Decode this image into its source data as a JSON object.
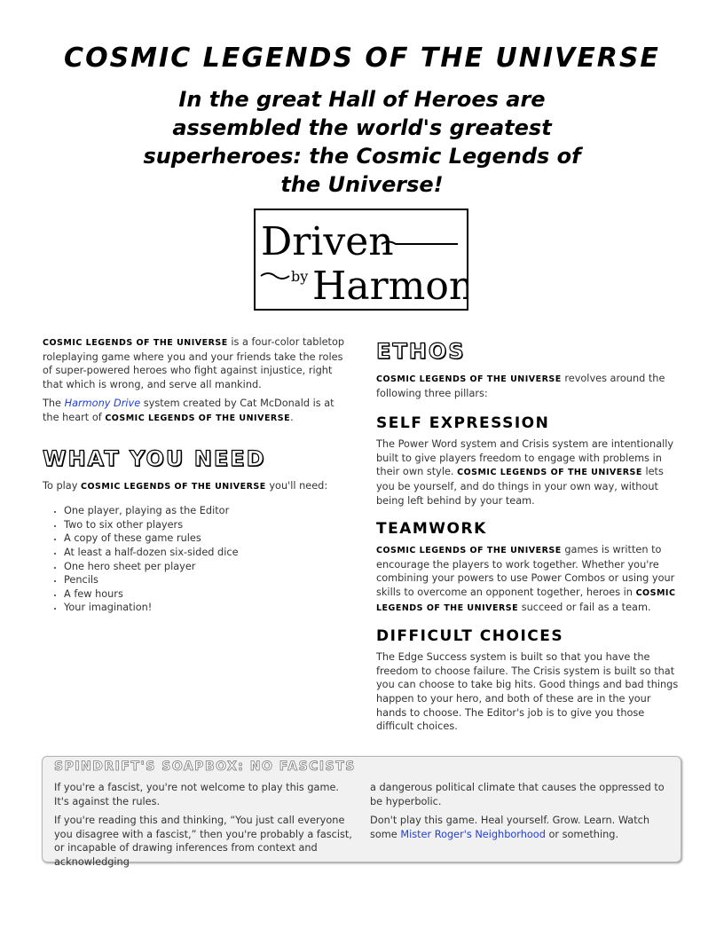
{
  "title": "Cosmic Legends of the Universe",
  "subtitle": "In the great Hall of Heroes are assembled the world's greatest superheroes: the Cosmic Legends of the Universe!",
  "logo": {
    "line1": "Driven",
    "by": "by",
    "line2": "Harmony"
  },
  "game_name": "Cosmic Legends of the Universe",
  "intro": {
    "p1_tail": " is a four-color tabletop roleplaying game where you and your friends take the roles of super-powered heroes who fight against injustice, right that which is wrong, and serve all mankind.",
    "p2_head": "The ",
    "p2_link": "Harmony Drive",
    "p2_mid": " system created by Cat McDonald is at the heart of ",
    "p2_tail": "."
  },
  "need": {
    "heading": "What You Need",
    "lead_head": "To play ",
    "lead_tail": " you'll need:",
    "items": [
      "One player, playing as the Editor",
      "Two to six other players",
      "A copy of these game rules",
      "At least a half-dozen six-sided dice",
      "One hero sheet per player",
      "Pencils",
      "A few hours",
      "Your imagination!"
    ]
  },
  "ethos": {
    "heading": "Ethos",
    "lead_tail": " revolves around the following three pillars:",
    "self_expression": {
      "heading": "Self Expression",
      "text_head": "The Power Word system and Crisis system are intentionally built to give players freedom to engage with problems in their own style. ",
      "text_tail": " lets you be yourself, and do things in your own way, without being left behind by your team."
    },
    "teamwork": {
      "heading": "Teamwork",
      "text_mid": " games is written to encourage the players to work together. Whether you're combining your powers to use Power Combos or using your skills to overcome an opponent together, heroes in ",
      "text_tail": " succeed or fail as a team."
    },
    "difficult_choices": {
      "heading": "Difficult Choices",
      "text": "The Edge Success system is built so that you have the freedom to choose failure. The Crisis system is built so that you can choose to take big hits. Good things and bad things happen to your hero, and both of these are in the your hands to choose. The Editor's job is to give you those difficult choices."
    }
  },
  "sidebar": {
    "title": "Spindrift's Soapbox: No Fascists",
    "p1": "If you're a fascist, you're not welcome to play this game. It's against the rules.",
    "p2": "If you're reading this and thinking, “You just call everyone you disagree with a fascist,” then you're probably a fascist, or incapable of drawing inferences from context and acknowledging",
    "p3": "a dangerous political climate that causes the oppressed to be hyperbolic.",
    "p4_head": "Don't play this game. Heal yourself. Grow. Learn. Watch some ",
    "p4_link": "Mister Roger's Neighborhood",
    "p4_tail": " or something."
  }
}
